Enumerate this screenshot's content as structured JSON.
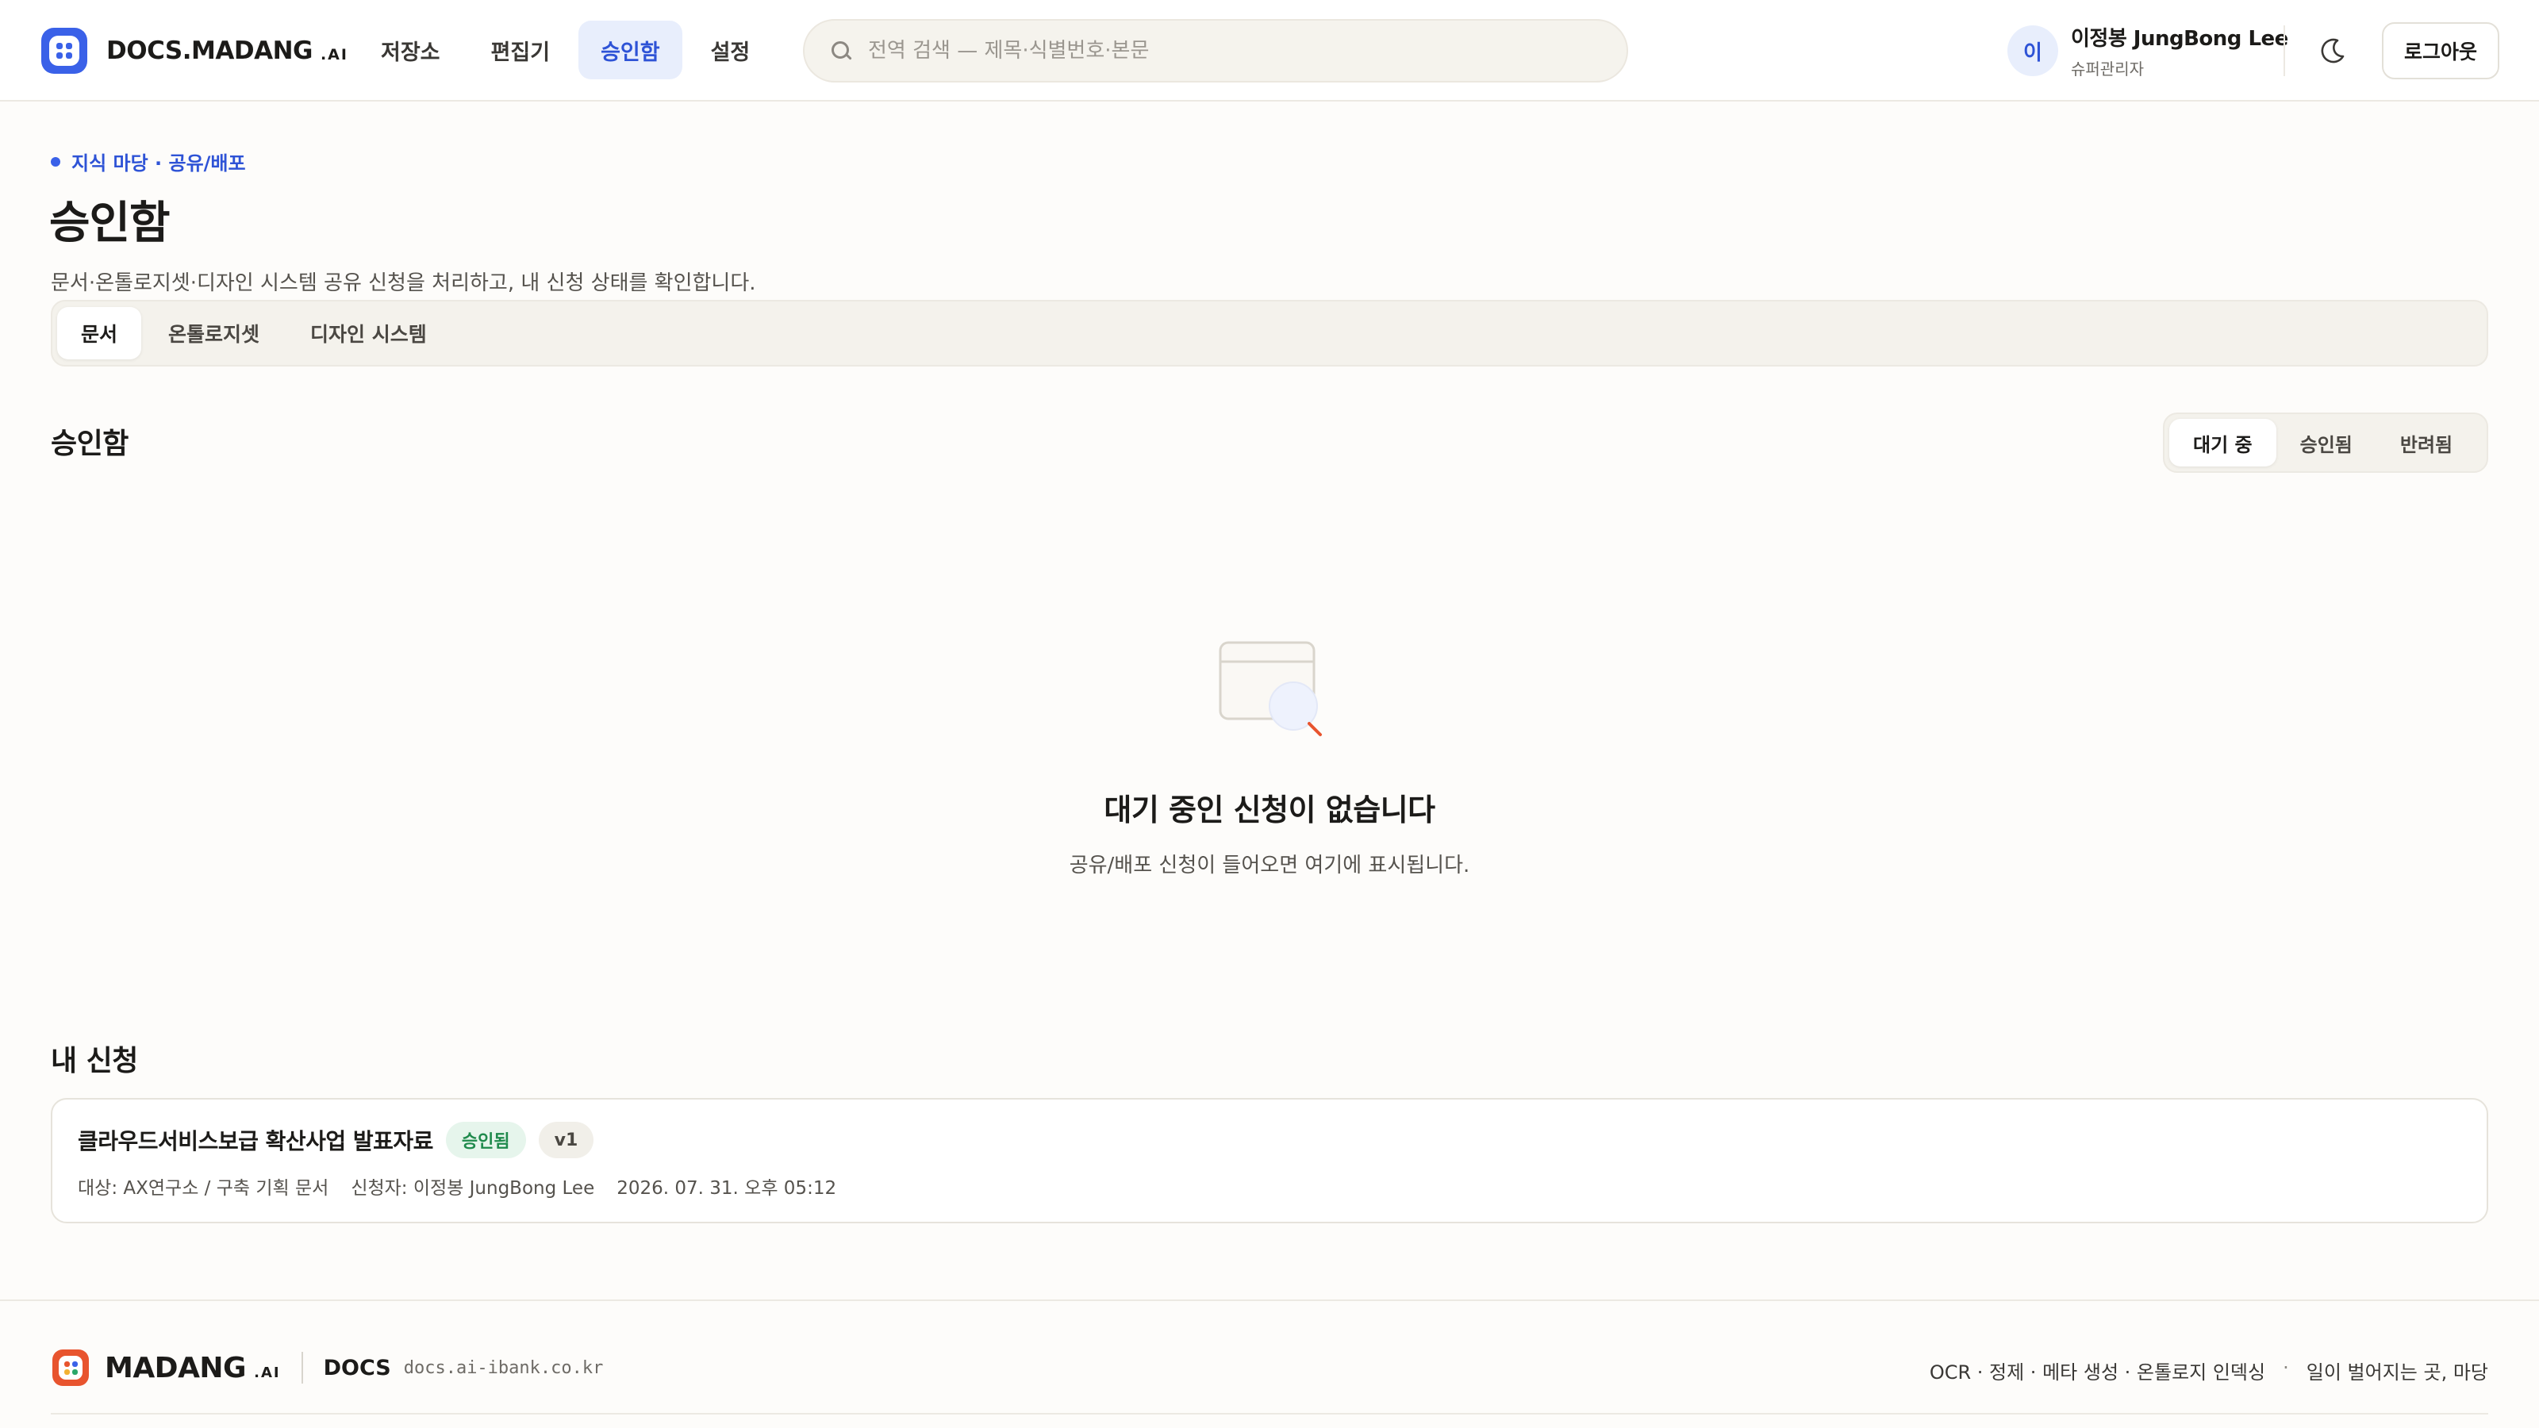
{
  "brand": {
    "name": "DOCS.MADANG",
    "suffix": ".AI"
  },
  "nav": {
    "items": [
      {
        "label": "저장소"
      },
      {
        "label": "편집기"
      },
      {
        "label": "승인함"
      },
      {
        "label": "설정"
      }
    ],
    "active": "승인함"
  },
  "search": {
    "placeholder": "전역 검색 — 제목·식별번호·본문",
    "value": ""
  },
  "user": {
    "avatar_initial": "이",
    "name": "이정봉 JungBong Lee",
    "role": "슈퍼관리자"
  },
  "header_actions": {
    "theme_icon": "moon-icon",
    "logout_label": "로그아웃"
  },
  "page": {
    "breadcrumb": "지식 마당 · 공유/배포",
    "title": "승인함",
    "description": "문서·온톨로지셋·디자인 시스템 공유 신청을 처리하고, 내 신청 상태를 확인합니다.",
    "tabs": [
      {
        "label": "문서"
      },
      {
        "label": "온톨로지셋"
      },
      {
        "label": "디자인 시스템"
      }
    ],
    "active_tab": "문서"
  },
  "approval_box": {
    "title": "승인함",
    "filters": [
      {
        "label": "대기 중"
      },
      {
        "label": "승인됨"
      },
      {
        "label": "반려됨"
      }
    ],
    "active_filter": "대기 중",
    "empty_title": "대기 중인 신청이 없습니다",
    "empty_desc": "공유/배포 신청이 들어오면 여기에 표시됩니다."
  },
  "my_requests": {
    "title": "내 신청",
    "items": [
      {
        "name": "클라우드서비스보급 확산사업 발표자료",
        "status": "승인됨",
        "version": "v1",
        "target": "대상: AX연구소 / 구축 기획 문서",
        "requester": "신청자: 이정봉 JungBong Lee",
        "date": "2026. 07. 31. 오후 05:12"
      }
    ]
  },
  "footer": {
    "brand": "MADANG",
    "brand_suffix": ".AI",
    "product": "DOCS",
    "url": "docs.ai-ibank.co.kr",
    "features": "OCR · 정제 · 메타 생성 · 온톨로지 인덱싱",
    "separator": "·",
    "tagline": "일이 벌어지는 곳, 마당"
  },
  "colors": {
    "accent": "#3a61e8",
    "accent_bg": "#e8eefc",
    "success": "#1f8a4c",
    "success_bg": "#e6f5ec",
    "footer_logo": "#e8542e"
  }
}
